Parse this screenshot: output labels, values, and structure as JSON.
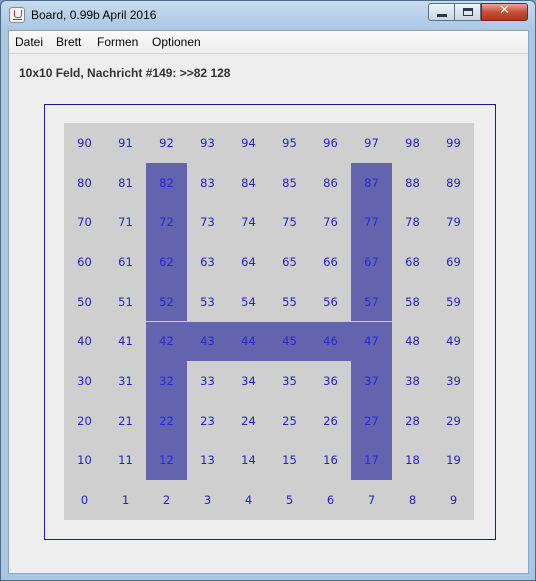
{
  "window": {
    "title": "Board, 0.99b April 2016",
    "icon": "java-cup-icon",
    "controls": {
      "minimize_icon": "minimize-icon",
      "maximize_icon": "maximize-icon",
      "close_icon": "close-icon",
      "close_label": "✕"
    }
  },
  "menu": {
    "items": [
      {
        "label": "Datei"
      },
      {
        "label": "Brett"
      },
      {
        "label": "Formen"
      },
      {
        "label": "Optionen"
      }
    ]
  },
  "status": {
    "message": "10x10 Feld, Nachricht #149: >>82 128"
  },
  "board": {
    "cols": 10,
    "rows": 10,
    "highlight_color": "#6464ae",
    "background_color": "#cfcfcf",
    "number_color": "#2222cc",
    "highlighted": [
      12,
      22,
      32,
      42,
      52,
      62,
      72,
      82,
      43,
      44,
      45,
      46,
      17,
      27,
      37,
      47,
      57,
      67,
      77,
      87
    ],
    "rows_top_to_bottom": [
      [
        90,
        91,
        92,
        93,
        94,
        95,
        96,
        97,
        98,
        99
      ],
      [
        80,
        81,
        82,
        83,
        84,
        85,
        86,
        87,
        88,
        89
      ],
      [
        70,
        71,
        72,
        73,
        74,
        75,
        76,
        77,
        78,
        79
      ],
      [
        60,
        61,
        62,
        63,
        64,
        65,
        66,
        67,
        68,
        69
      ],
      [
        50,
        51,
        52,
        53,
        54,
        55,
        56,
        57,
        58,
        59
      ],
      [
        40,
        41,
        42,
        43,
        44,
        45,
        46,
        47,
        48,
        49
      ],
      [
        30,
        31,
        32,
        33,
        34,
        35,
        36,
        37,
        38,
        39
      ],
      [
        20,
        21,
        22,
        23,
        24,
        25,
        26,
        27,
        28,
        29
      ],
      [
        10,
        11,
        12,
        13,
        14,
        15,
        16,
        17,
        18,
        19
      ],
      [
        0,
        1,
        2,
        3,
        4,
        5,
        6,
        7,
        8,
        9
      ]
    ]
  }
}
